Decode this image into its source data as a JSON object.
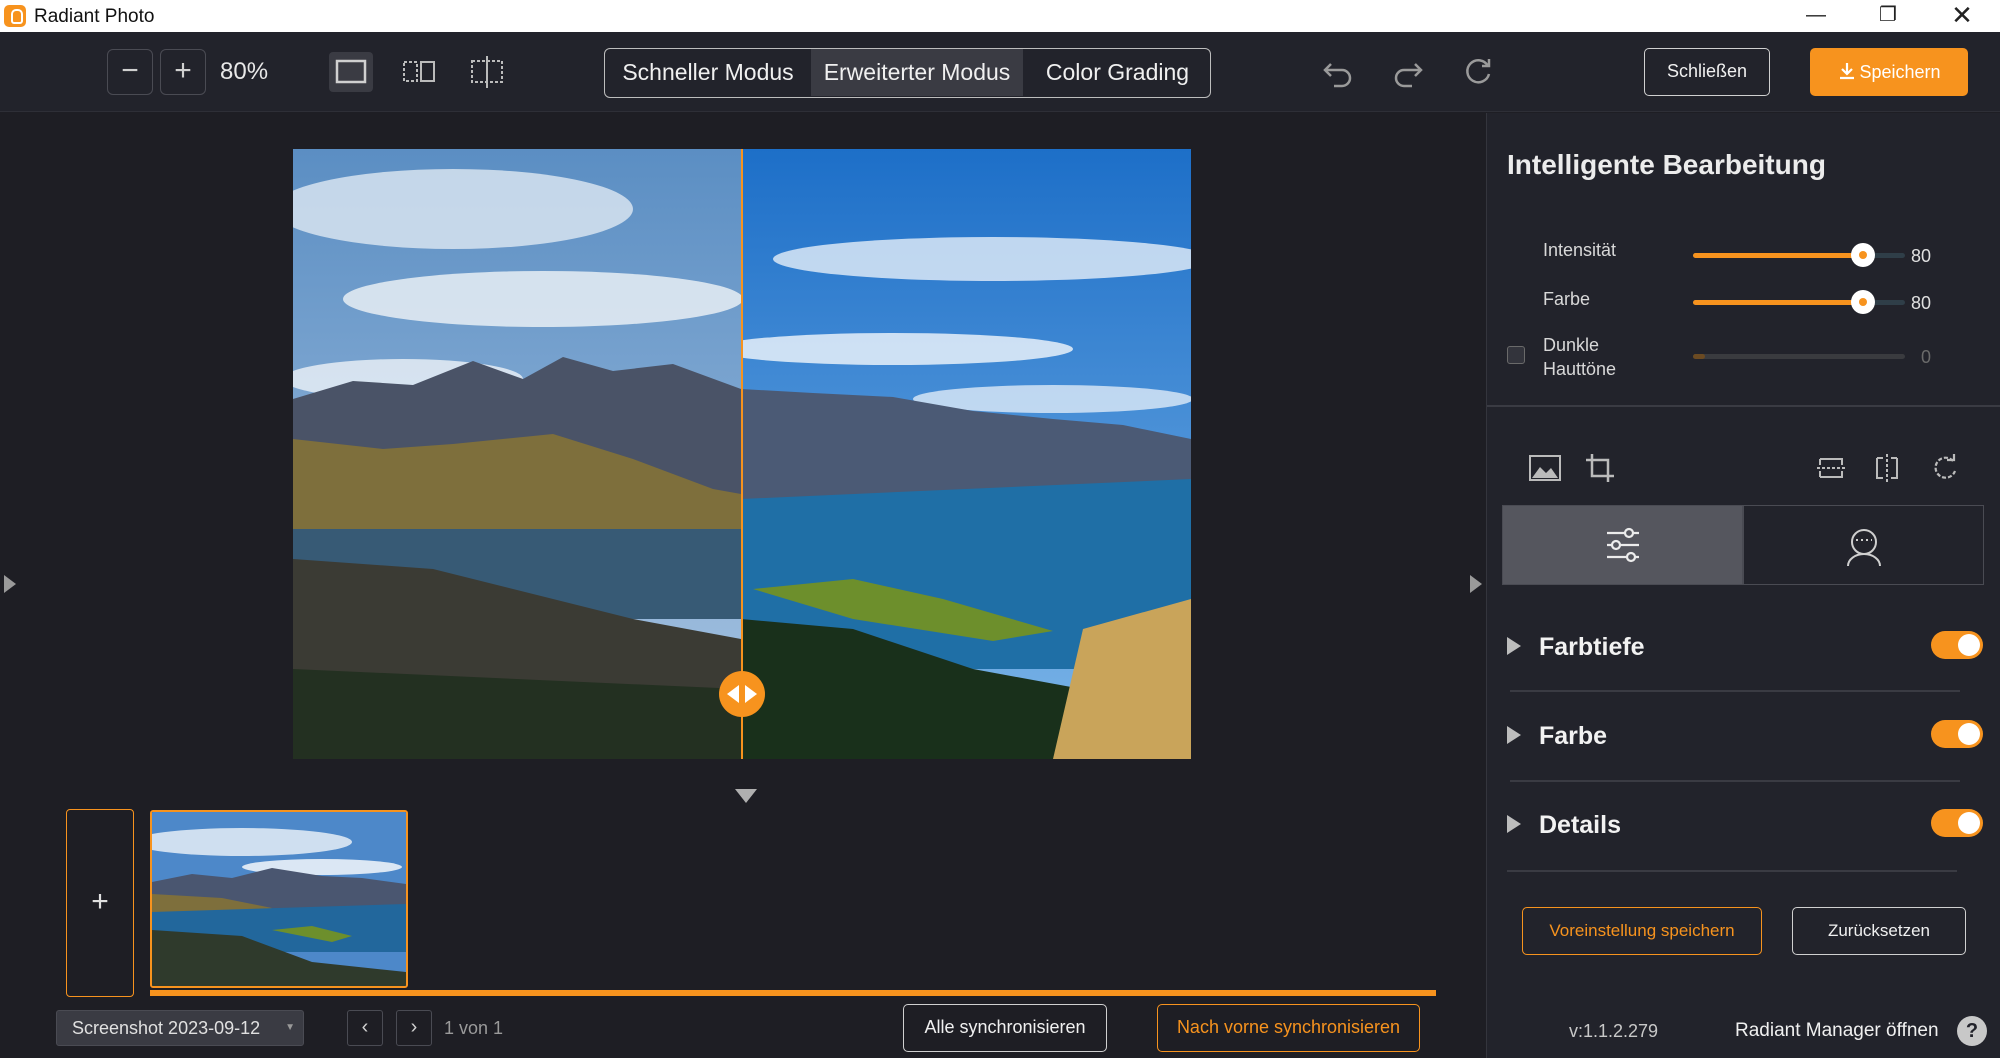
{
  "window": {
    "title": "Radiant Photo",
    "minimize_glyph": "—",
    "maximize_glyph": "❐",
    "close_glyph": "✕"
  },
  "toolbar": {
    "zoom_out_glyph": "−",
    "zoom_in_glyph": "+",
    "zoom_level": "80%",
    "modes": [
      "Schneller Modus",
      "Erweiterter Modus",
      "Color Grading"
    ],
    "active_mode": "Erweiterter Modus",
    "close_label": "Schließen",
    "save_label": "Speichern"
  },
  "canvas": {
    "split_position": 0.5,
    "image_name": "Screenshot 2023-09-12"
  },
  "filmstrip": {
    "add_glyph": "+",
    "progress": 1.0
  },
  "bottom_bar": {
    "file_select": "Screenshot 2023-09-12",
    "prev_glyph": "‹",
    "next_glyph": "›",
    "page_label": "1 von 1",
    "sync_all_label": "Alle synchronisieren",
    "sync_forward_label": "Nach vorne synchronisieren"
  },
  "panel": {
    "title": "Intelligente Bearbeitung",
    "sliders": [
      {
        "label": "Intensität",
        "value": "80",
        "fraction": 0.8,
        "enabled": true
      },
      {
        "label": "Farbe",
        "value": "80",
        "fraction": 0.8,
        "enabled": true
      },
      {
        "label": "Dunkle Hauttöne",
        "value": "0",
        "fraction": 0.0,
        "enabled": false
      }
    ],
    "tools": [
      "image-icon",
      "crop-icon",
      "flip-vertical-icon",
      "flip-horizontal-icon",
      "rotate-icon"
    ],
    "tabs": [
      "sliders-icon",
      "face-icon"
    ],
    "sections": [
      {
        "label": "Farbtiefe",
        "enabled": true
      },
      {
        "label": "Farbe",
        "enabled": true
      },
      {
        "label": "Details",
        "enabled": true
      }
    ],
    "save_preset_label": "Voreinstellung speichern",
    "reset_label": "Zurücksetzen",
    "version": "v:1.1.2.279",
    "manager_label": "Radiant Manager öffnen",
    "help_glyph": "?"
  },
  "colors": {
    "accent": "#f7931e",
    "background": "#1e1e24",
    "panel": "#22232b"
  }
}
